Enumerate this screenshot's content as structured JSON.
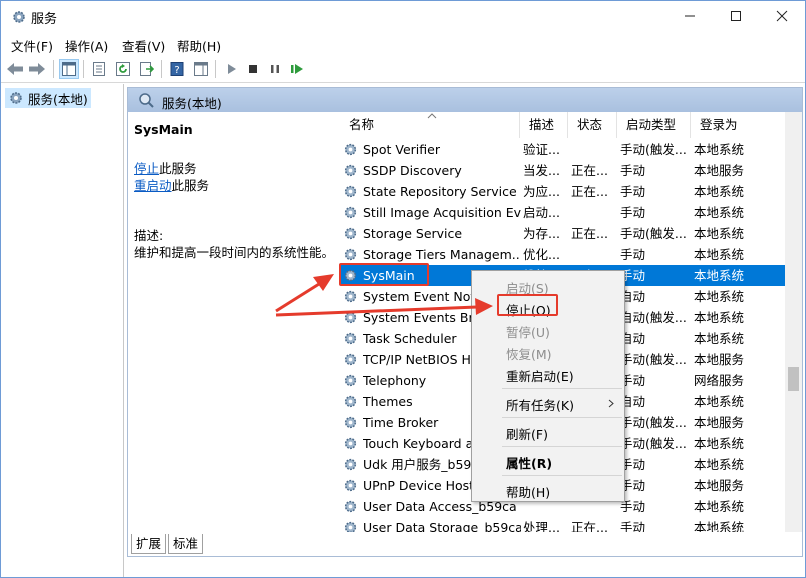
{
  "window": {
    "title": "服务"
  },
  "menu": {
    "items": [
      "文件(F)",
      "操作(A)",
      "查看(V)",
      "帮助(H)"
    ]
  },
  "tree": {
    "root": "服务(本地)"
  },
  "panel": {
    "header": "服务(本地)",
    "service_name": "SysMain",
    "stop_link": "停止",
    "stop_suffix": "此服务",
    "restart_link": "重启动",
    "restart_suffix": "此服务",
    "desc_label": "描述:",
    "desc_text": "维护和提高一段时间内的系统性能。"
  },
  "columns": {
    "name": "名称",
    "desc": "描述",
    "status": "状态",
    "startup": "启动类型",
    "logon": "登录为"
  },
  "services": [
    {
      "name": "Spot Verifier",
      "desc": "验证...",
      "status": "",
      "startup": "手动(触发...",
      "logon": "本地系统"
    },
    {
      "name": "SSDP Discovery",
      "desc": "当发...",
      "status": "正在...",
      "startup": "手动",
      "logon": "本地服务"
    },
    {
      "name": "State Repository Service",
      "desc": "为应...",
      "status": "正在...",
      "startup": "手动",
      "logon": "本地系统"
    },
    {
      "name": "Still Image Acquisition Ev...",
      "desc": "启动...",
      "status": "",
      "startup": "手动",
      "logon": "本地系统"
    },
    {
      "name": "Storage Service",
      "desc": "为存...",
      "status": "正在...",
      "startup": "手动(触发...",
      "logon": "本地系统"
    },
    {
      "name": "Storage Tiers Managem...",
      "desc": "优化...",
      "status": "",
      "startup": "手动",
      "logon": "本地系统"
    },
    {
      "name": "SysMain",
      "desc": "维护...",
      "status": "正在...",
      "startup": "手动",
      "logon": "本地系统"
    },
    {
      "name": "System Event Notific...",
      "desc": "",
      "status": "",
      "startup": "自动",
      "logon": "本地系统"
    },
    {
      "name": "System Events Broker",
      "desc": "",
      "status": "",
      "startup": "自动(触发...",
      "logon": "本地系统"
    },
    {
      "name": "Task Scheduler",
      "desc": "",
      "status": "",
      "startup": "自动",
      "logon": "本地系统"
    },
    {
      "name": "TCP/IP NetBIOS Helper",
      "desc": "",
      "status": "",
      "startup": "手动(触发...",
      "logon": "本地服务"
    },
    {
      "name": "Telephony",
      "desc": "",
      "status": "",
      "startup": "手动",
      "logon": "网络服务"
    },
    {
      "name": "Themes",
      "desc": "",
      "status": "",
      "startup": "自动",
      "logon": "本地系统"
    },
    {
      "name": "Time Broker",
      "desc": "",
      "status": "",
      "startup": "手动(触发...",
      "logon": "本地服务"
    },
    {
      "name": "Touch Keyboard and Hand...",
      "desc": "",
      "status": "",
      "startup": "手动(触发...",
      "logon": "本地系统"
    },
    {
      "name": "Udk 用户服务_b59ca",
      "desc": "",
      "status": "",
      "startup": "手动",
      "logon": "本地系统"
    },
    {
      "name": "UPnP Device Host",
      "desc": "",
      "status": "",
      "startup": "手动",
      "logon": "本地服务"
    },
    {
      "name": "User Data Access_b59ca",
      "desc": "",
      "status": "",
      "startup": "手动",
      "logon": "本地系统"
    },
    {
      "name": "User Data Storage_b59ca",
      "desc": "处理...",
      "status": "正在...",
      "startup": "手动",
      "logon": "本地系统"
    }
  ],
  "context_menu": {
    "start": "启动(S)",
    "stop": "停止(O)",
    "pause": "暂停(U)",
    "resume": "恢复(M)",
    "restart": "重新启动(E)",
    "all_tasks": "所有任务(K)",
    "refresh": "刷新(F)",
    "properties": "属性(R)",
    "help": "帮助(H)"
  },
  "tabs": {
    "extended": "扩展",
    "standard": "标准"
  },
  "colors": {
    "selection": "#0078d7",
    "annotation": "#e53b2c",
    "link": "#0a5bc4"
  }
}
